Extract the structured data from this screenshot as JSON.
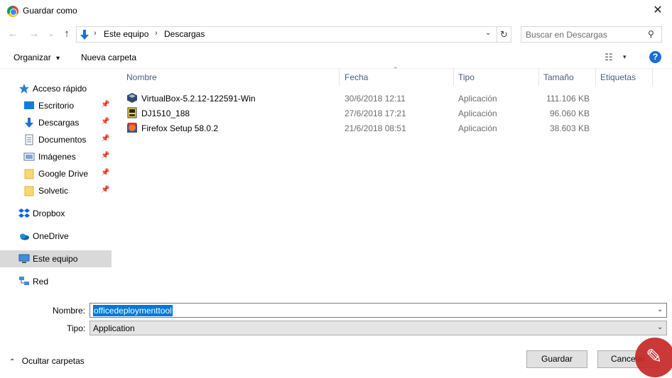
{
  "window": {
    "title": "Guardar como",
    "close_glyph": "✕"
  },
  "nav": {
    "back": "←",
    "forward": "→",
    "recent": "⌄",
    "up": "↑"
  },
  "address": {
    "crumbs": [
      "Este equipo",
      "Descargas"
    ],
    "separator": "›",
    "dropdown": "⌄",
    "refresh": "↻"
  },
  "search": {
    "placeholder": "Buscar en Descargas",
    "icon": "⚲"
  },
  "toolbar": {
    "organize": "Organizar",
    "organize_caret": "▾",
    "new_folder": "Nueva carpeta",
    "view_icon": "☷",
    "view_caret": "▾",
    "help": "?"
  },
  "sidebar": {
    "items": [
      {
        "label": "Acceso rápido",
        "icon": "star-icon",
        "pinned": false
      },
      {
        "label": "Escritorio",
        "icon": "desktop-icon",
        "pinned": true
      },
      {
        "label": "Descargas",
        "icon": "download-icon",
        "pinned": true
      },
      {
        "label": "Documentos",
        "icon": "documents-icon",
        "pinned": true
      },
      {
        "label": "Imágenes",
        "icon": "pictures-icon",
        "pinned": true
      },
      {
        "label": "Google Drive",
        "icon": "folder-icon",
        "pinned": true
      },
      {
        "label": "Solvetic",
        "icon": "folder-icon",
        "pinned": true
      },
      {
        "label": "Dropbox",
        "icon": "dropbox-icon",
        "pinned": false
      },
      {
        "label": "OneDrive",
        "icon": "onedrive-icon",
        "pinned": false
      },
      {
        "label": "Este equipo",
        "icon": "computer-icon",
        "pinned": false,
        "selected": true
      },
      {
        "label": "Red",
        "icon": "network-icon",
        "pinned": false
      }
    ],
    "pin_glyph": "📌"
  },
  "columns": {
    "name": "Nombre",
    "date": "Fecha",
    "type": "Tipo",
    "size": "Tamaño",
    "tags": "Etiquetas",
    "sort_glyph": "⌃"
  },
  "files": [
    {
      "name": "VirtualBox-5.2.12-122591-Win",
      "date": "30/6/2018 12:11",
      "type": "Aplicación",
      "size": "111.106 KB",
      "icon": "virtualbox-icon"
    },
    {
      "name": "DJ1510_188",
      "date": "27/6/2018 17:21",
      "type": "Aplicación",
      "size": "96.060 KB",
      "icon": "installer-icon"
    },
    {
      "name": "Firefox Setup 58.0.2",
      "date": "21/6/2018 08:51",
      "type": "Aplicación",
      "size": "38.603 KB",
      "icon": "firefox-setup-icon"
    }
  ],
  "form": {
    "name_label": "Nombre:",
    "name_value": "officedeploymenttool",
    "type_label": "Tipo:",
    "type_value": "Application",
    "dropdown": "⌄"
  },
  "footer": {
    "hide_folders": "Ocultar carpetas",
    "hide_caret": "⌃",
    "save": "Guardar",
    "cancel": "Cancelar"
  },
  "colors": {
    "accent": "#0078d7",
    "selection_bg": "#d9d9d9",
    "column_header": "#4c607a"
  }
}
